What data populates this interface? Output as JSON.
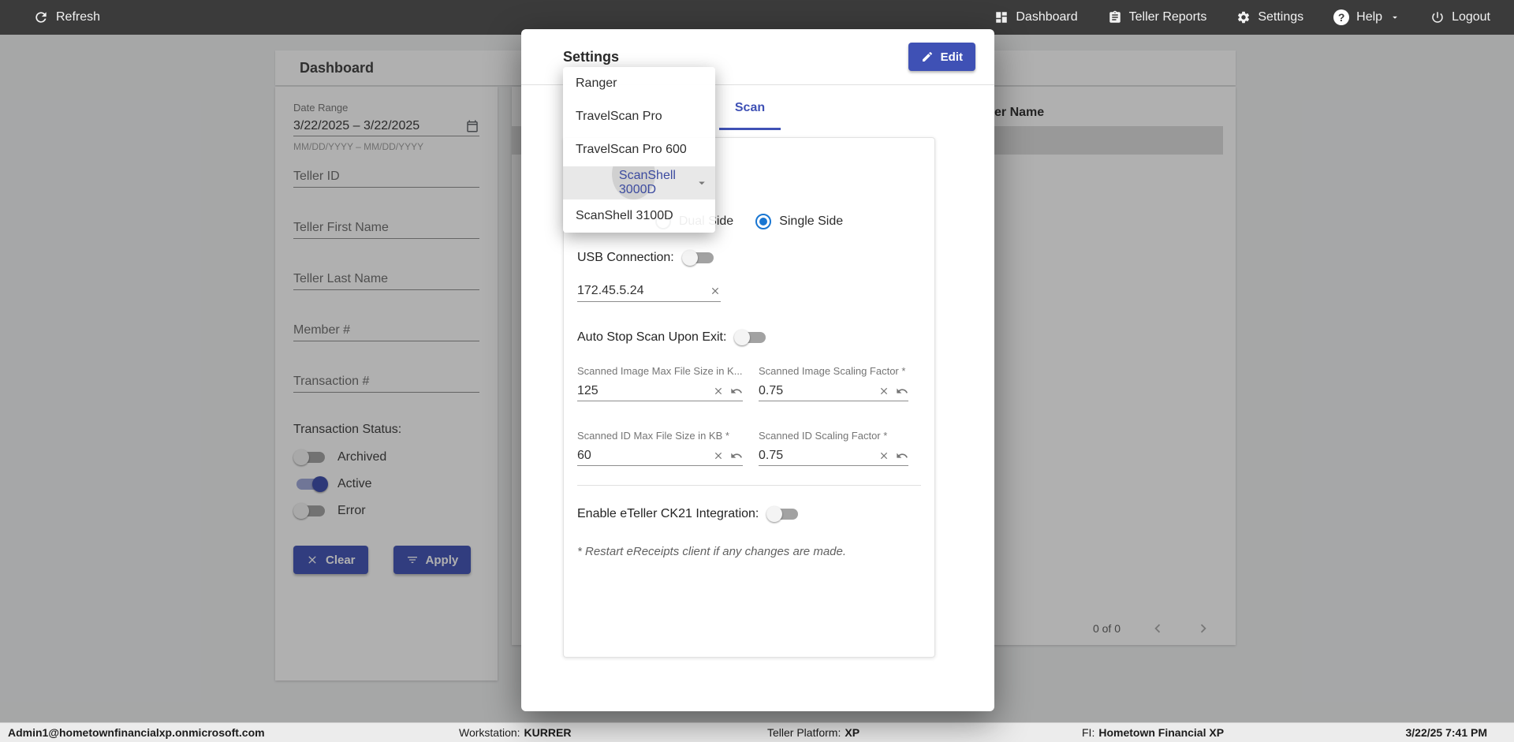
{
  "theme": {
    "accent": "#3f51b5",
    "radio_blue": "#1976d2",
    "topbar_bg": "#3b3b3b"
  },
  "topbar": {
    "refresh": "Refresh",
    "dashboard": "Dashboard",
    "teller_reports": "Teller Reports",
    "settings": "Settings",
    "help": "Help",
    "logout": "Logout"
  },
  "dashboard": {
    "title": "Dashboard",
    "filters": {
      "date_range": {
        "label": "Date Range",
        "value": "3/22/2025 – 3/22/2025",
        "hint": "MM/DD/YYYY – MM/DD/YYYY"
      },
      "teller_id": {
        "placeholder": "Teller ID"
      },
      "teller_first_name": {
        "placeholder": "Teller First Name"
      },
      "teller_last_name": {
        "placeholder": "Teller Last Name"
      },
      "member_number": {
        "placeholder": "Member #"
      },
      "transaction_number": {
        "placeholder": "Transaction #"
      },
      "status": {
        "label": "Transaction Status:",
        "toggles": [
          {
            "label": "Archived",
            "on": false
          },
          {
            "label": "Active",
            "on": true
          },
          {
            "label": "Error",
            "on": false
          }
        ]
      },
      "clear_button": "Clear",
      "apply_button": "Apply"
    },
    "table": {
      "visible_column_header": "er Name"
    },
    "pagination": {
      "label": "0 of 0"
    }
  },
  "modal": {
    "title": "Settings",
    "edit_button": "Edit",
    "active_tab": "Scan",
    "scan": {
      "side_options": [
        {
          "label": "Dual Side",
          "selected": false
        },
        {
          "label": "Single Side",
          "selected": true
        }
      ],
      "usb_label": "USB Connection:",
      "usb_on": false,
      "ip_value": "172.45.5.24",
      "auto_stop_label": "Auto Stop Scan Upon Exit:",
      "auto_stop_on": false,
      "number_fields": [
        {
          "label": "Scanned Image Max File Size in K...",
          "value": "125"
        },
        {
          "label": "Scanned Image Scaling Factor *",
          "value": "0.75"
        },
        {
          "label": "Scanned ID Max File Size in KB *",
          "value": "60"
        },
        {
          "label": "Scanned ID Scaling Factor *",
          "value": "0.75"
        }
      ],
      "eteller_label": "Enable eTeller CK21 Integration:",
      "eteller_on": false,
      "note": "* Restart eReceipts client if any changes are made."
    }
  },
  "scanner_menu": {
    "selected": "ScanShell 3000D",
    "options": [
      {
        "label": "Ranger",
        "selected": false
      },
      {
        "label": "TravelScan Pro",
        "selected": false
      },
      {
        "label": "TravelScan Pro 600",
        "selected": false
      },
      {
        "label": "ScanShell 3000D",
        "selected": true
      },
      {
        "label": "ScanShell 3100D",
        "selected": false
      }
    ]
  },
  "statusbar": {
    "user": "Admin1@hometownfinancialxp.onmicrosoft.com",
    "workstation_label": "Workstation:",
    "workstation_value": "KURRER",
    "platform_label": "Teller Platform:",
    "platform_value": "XP",
    "fi_label": "FI:",
    "fi_value": "Hometown Financial XP",
    "datetime": "3/22/25 7:41 PM"
  },
  "icons": {
    "refresh-icon": "circular refresh arrow",
    "dashboard-icon": "dashboard tiles",
    "teller-reports-icon": "report clipboard",
    "settings-icon": "gear",
    "help-icon": "question mark in circle",
    "chevron-down-icon": "caret down",
    "logout-icon": "power symbol",
    "calendar-icon": "calendar",
    "clear-icon": "x cross",
    "apply-filter-icon": "filter list lines",
    "edit-icon": "pencil",
    "close-icon": "x cross",
    "undo-icon": "undo arrow",
    "select-arrow-icon": "caret down",
    "chevron-left-icon": "chevron left",
    "chevron-right-icon": "chevron right"
  }
}
